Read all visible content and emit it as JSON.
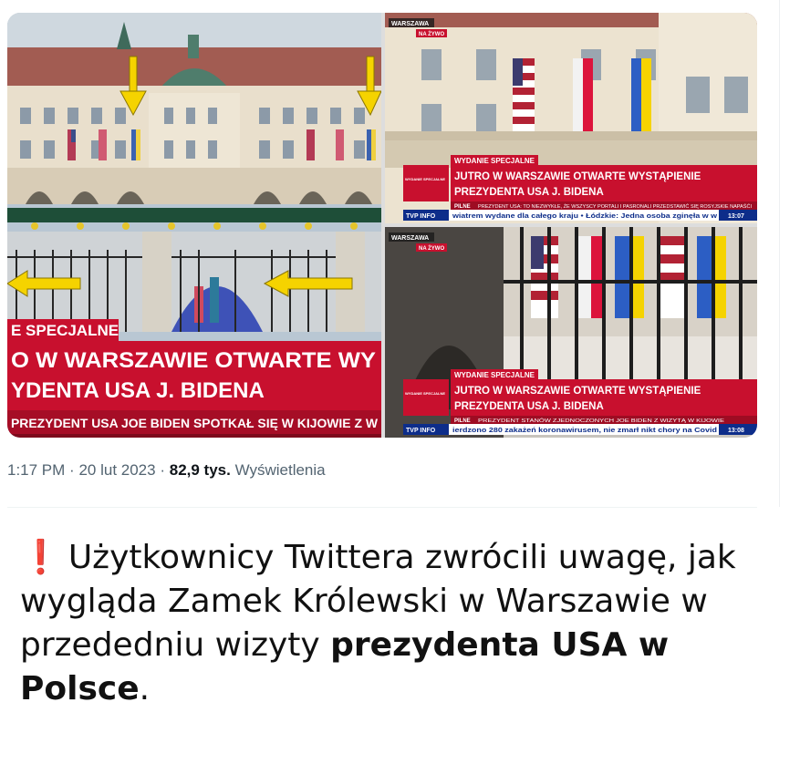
{
  "photos": {
    "left": {
      "ticker_special": "E SPECJALNE",
      "headline_1": "O W WARSZAWIE OTWARTE WY",
      "headline_2": "YDENTA USA J. BIDENA",
      "crawl": "PREZYDENT USA JOE BIDEN SPOTKAŁ SIĘ W KIJOWIE Z W"
    },
    "top_right": {
      "corner_tag_1": "WARSZAWA",
      "corner_tag_2": "NA ŻYWO",
      "special_tag": "WYDANIE SPECJALNE",
      "headline_1": "JUTRO W WARSZAWIE OTWARTE WYSTĄPIENIE",
      "headline_2": "PREZYDENTA USA J. BIDENA",
      "pilne_label": "PILNE",
      "pilne_text": "PREZYDENT USA: TO NIEZWYKŁE, ŻE WSZYSCY PORTALI I PASRONALI PRZEDSTAWIĆ SIĘ ROSYJSKIE NAPAŚĆI",
      "channel": "TVP INFO",
      "crawl": "wiatrem wydane dla całego kraju • Łódzkie: Jedna osoba zginęła w w",
      "time": "13:07",
      "logo_small": "WYDANIE SPECJALNE"
    },
    "bottom_right": {
      "corner_tag_1": "WARSZAWA",
      "corner_tag_2": "NA ŻYWO",
      "special_tag": "WYDANIE SPECJALNE",
      "headline_1": "JUTRO W WARSZAWIE OTWARTE WYSTĄPIENIE",
      "headline_2": "PREZYDENTA USA J. BIDENA",
      "pilne_label": "PILNE",
      "pilne_text": "PREZYDENT STANÓW ZJEDNOCZONYCH JOE BIDEN Z WIZYTĄ W KIJOWIE",
      "channel": "TVP INFO",
      "crawl": "ierdzono 280 zakażeń koronawirusem, nie zmarł nikt chory na Covid",
      "time": "13:08",
      "logo_small": "WYDANIE SPECJALNE"
    }
  },
  "tweet": {
    "time": "1:17 PM",
    "date": "20 lut 2023",
    "separator": "·",
    "views_count": "82,9 tys.",
    "views_label": "Wyświetlenia"
  },
  "caption": {
    "icon": "❗",
    "text_regular": "Użytkownicy Twittera zwrócili uwagę, jak wygląda Zamek Królewski w Warszawie w przededniu wizyty ",
    "text_bold": "prezydenta USA w Polsce",
    "text_end": "."
  },
  "colors": {
    "tvp_red": "#c8102e",
    "arrow_yellow": "#f5d300",
    "building_cream": "#e7dcc8",
    "roof": "#9b5a52",
    "twitter_gray": "#536471"
  }
}
